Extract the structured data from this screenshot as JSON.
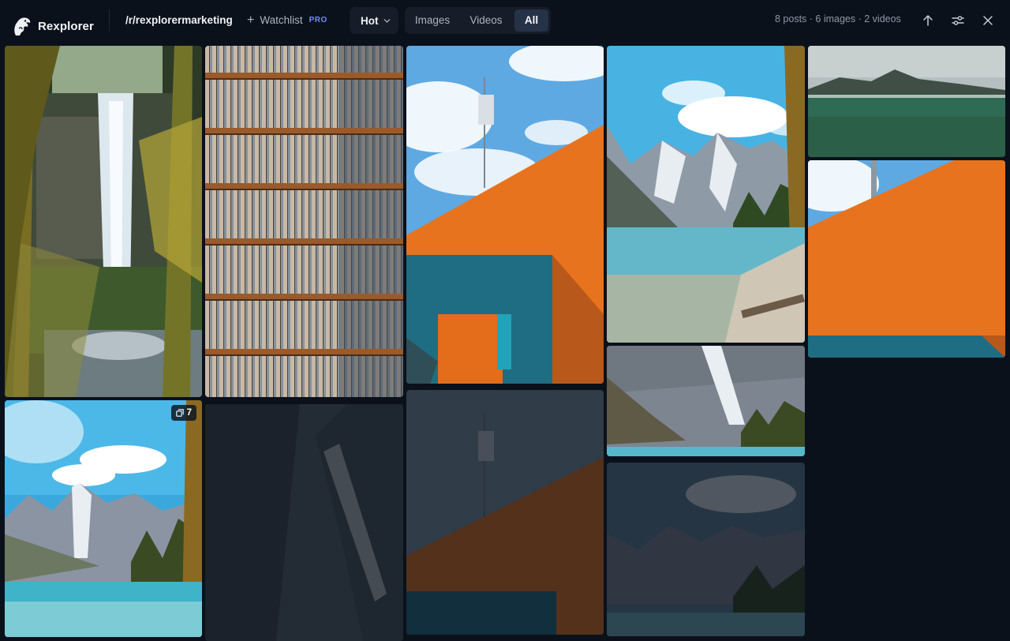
{
  "app": {
    "name": "Rexplorer"
  },
  "header": {
    "subreddit": "/r/rexplorermarketing",
    "watchlist_label": "Watchlist",
    "watchlist_badge": "PRO",
    "sort": {
      "selected": "Hot"
    },
    "filter": {
      "options": [
        "Images",
        "Videos",
        "All"
      ],
      "active": "All"
    },
    "counts": "8 posts · 6 images · 2 videos"
  },
  "grid": {
    "tiles": [
      {
        "id": "waterfall",
        "subject": "waterfall"
      },
      {
        "id": "facade",
        "subject": "building-facade"
      },
      {
        "id": "orange-wall",
        "subject": "orange-wall"
      },
      {
        "id": "lake-mountains",
        "subject": "mountain-lake"
      },
      {
        "id": "aerial-island",
        "subject": "island"
      },
      {
        "id": "orange-wall-crop",
        "subject": "orange-wall"
      },
      {
        "id": "mountains-forest",
        "subject": "mountain-lake"
      },
      {
        "id": "lake-gallery",
        "subject": "mountain-lake",
        "badge": "7"
      },
      {
        "id": "dark-mountain",
        "subject": "mountain"
      },
      {
        "id": "orange-wall-dim",
        "subject": "orange-wall"
      },
      {
        "id": "lake-dim",
        "subject": "mountain-lake"
      }
    ]
  },
  "colors": {
    "background": "#0b111b",
    "accent_pro": "#6f8df5",
    "control_bg": "#161d28",
    "segment_active": "#263247",
    "orange_wall": "#e8731e",
    "teal_wall": "#1f6d82"
  },
  "icons": {
    "logo": "rexplorer-logo-icon",
    "watchlist": "plus-icon",
    "sort": "chevron-down-icon",
    "scroll_top": "arrow-up-icon",
    "settings": "sliders-icon",
    "close": "close-icon",
    "gallery": "gallery-icon"
  }
}
